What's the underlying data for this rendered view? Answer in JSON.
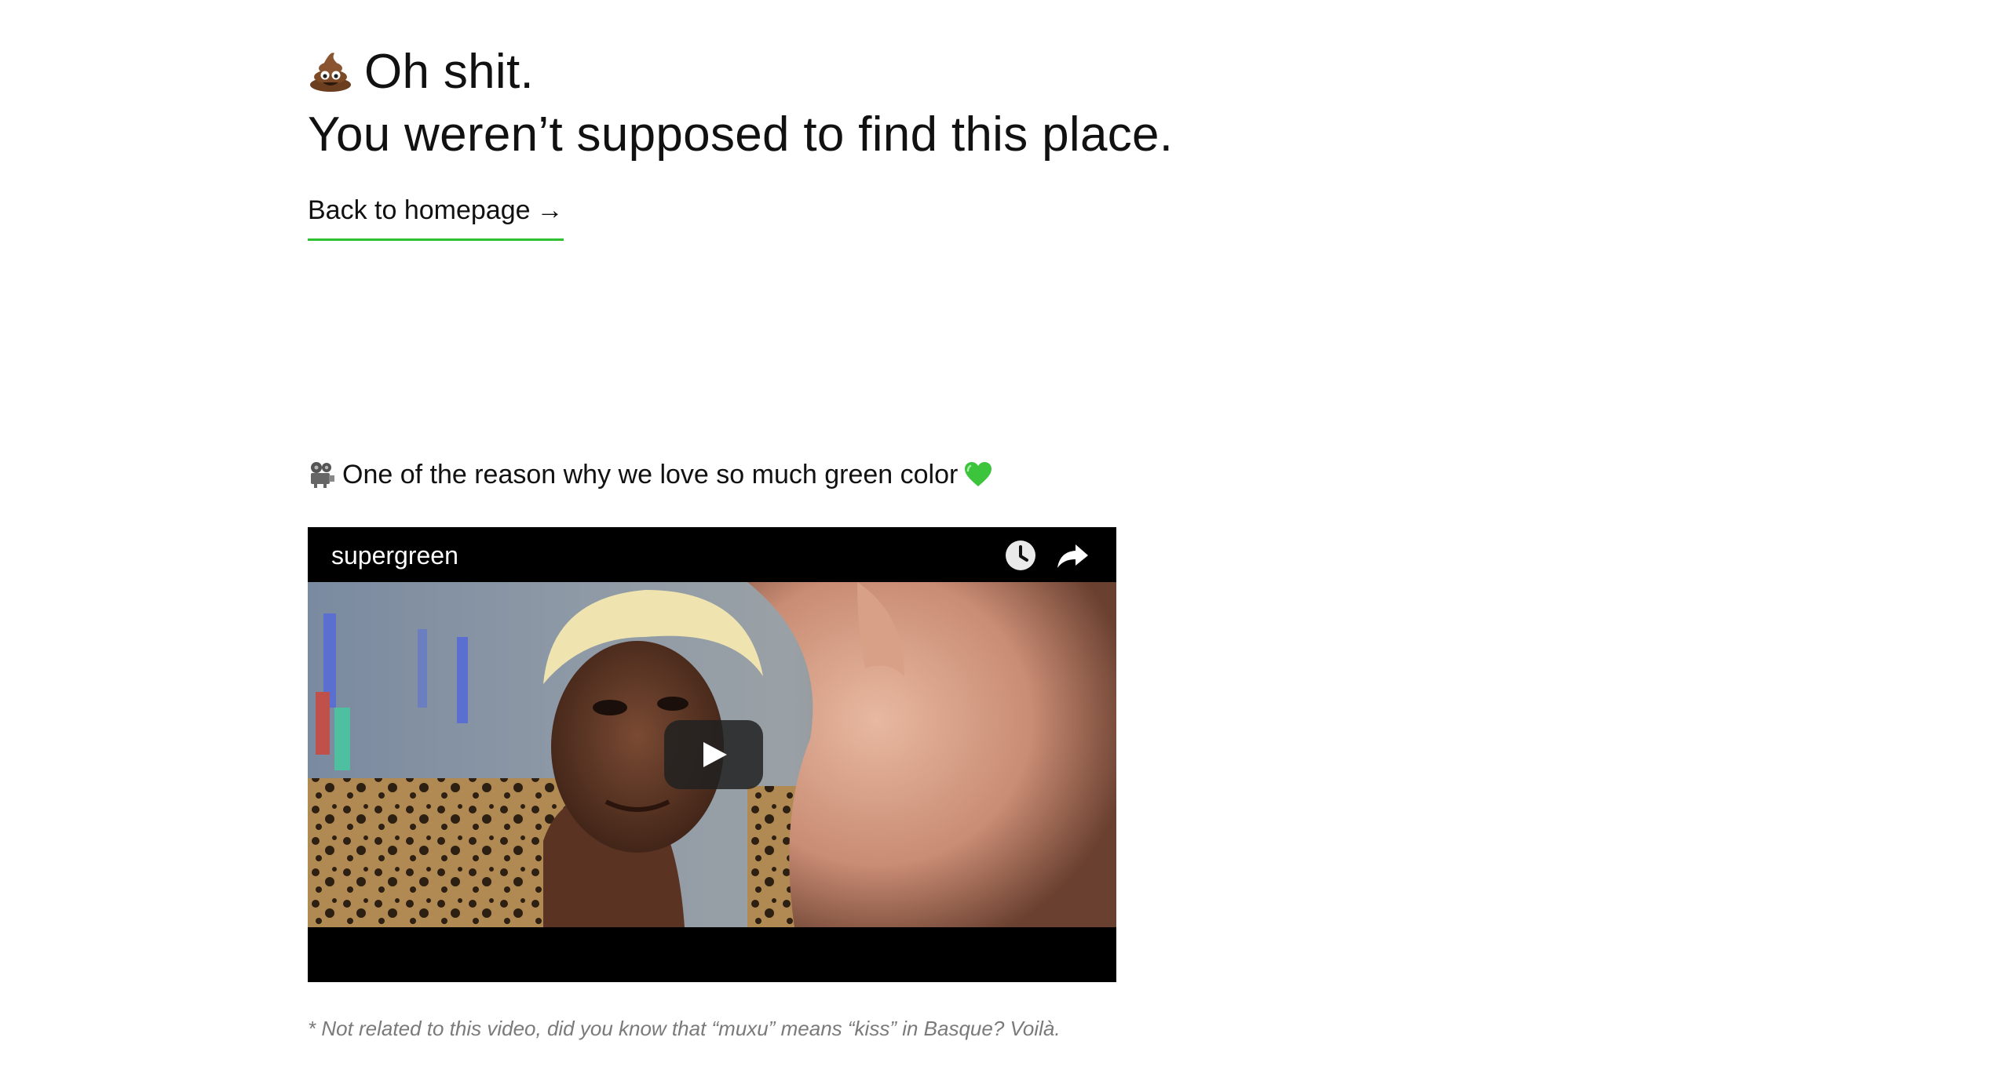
{
  "header": {
    "line1": "Oh shit.",
    "line2": "You weren’t supposed to find this place.",
    "emoji_icon": "pile-of-poo-icon"
  },
  "back_link": {
    "label": "Back to homepage",
    "arrow": "→",
    "underline_color": "#2fc02f"
  },
  "section": {
    "title": "One of the reason why we love so much green color",
    "leading_icon": "film-projector-icon",
    "trailing_icon": "green-heart-icon"
  },
  "video": {
    "title": "supergreen",
    "watch_later_icon": "clock-icon",
    "share_icon": "share-arrow-icon",
    "play_icon": "play-icon"
  },
  "footnote": {
    "text": "* Not related to this video, did you know that “muxu” means “kiss” in Basque? Voilà."
  },
  "colors": {
    "accent_green": "#2fc02f",
    "text": "#111111",
    "muted": "#7a7a7a"
  }
}
